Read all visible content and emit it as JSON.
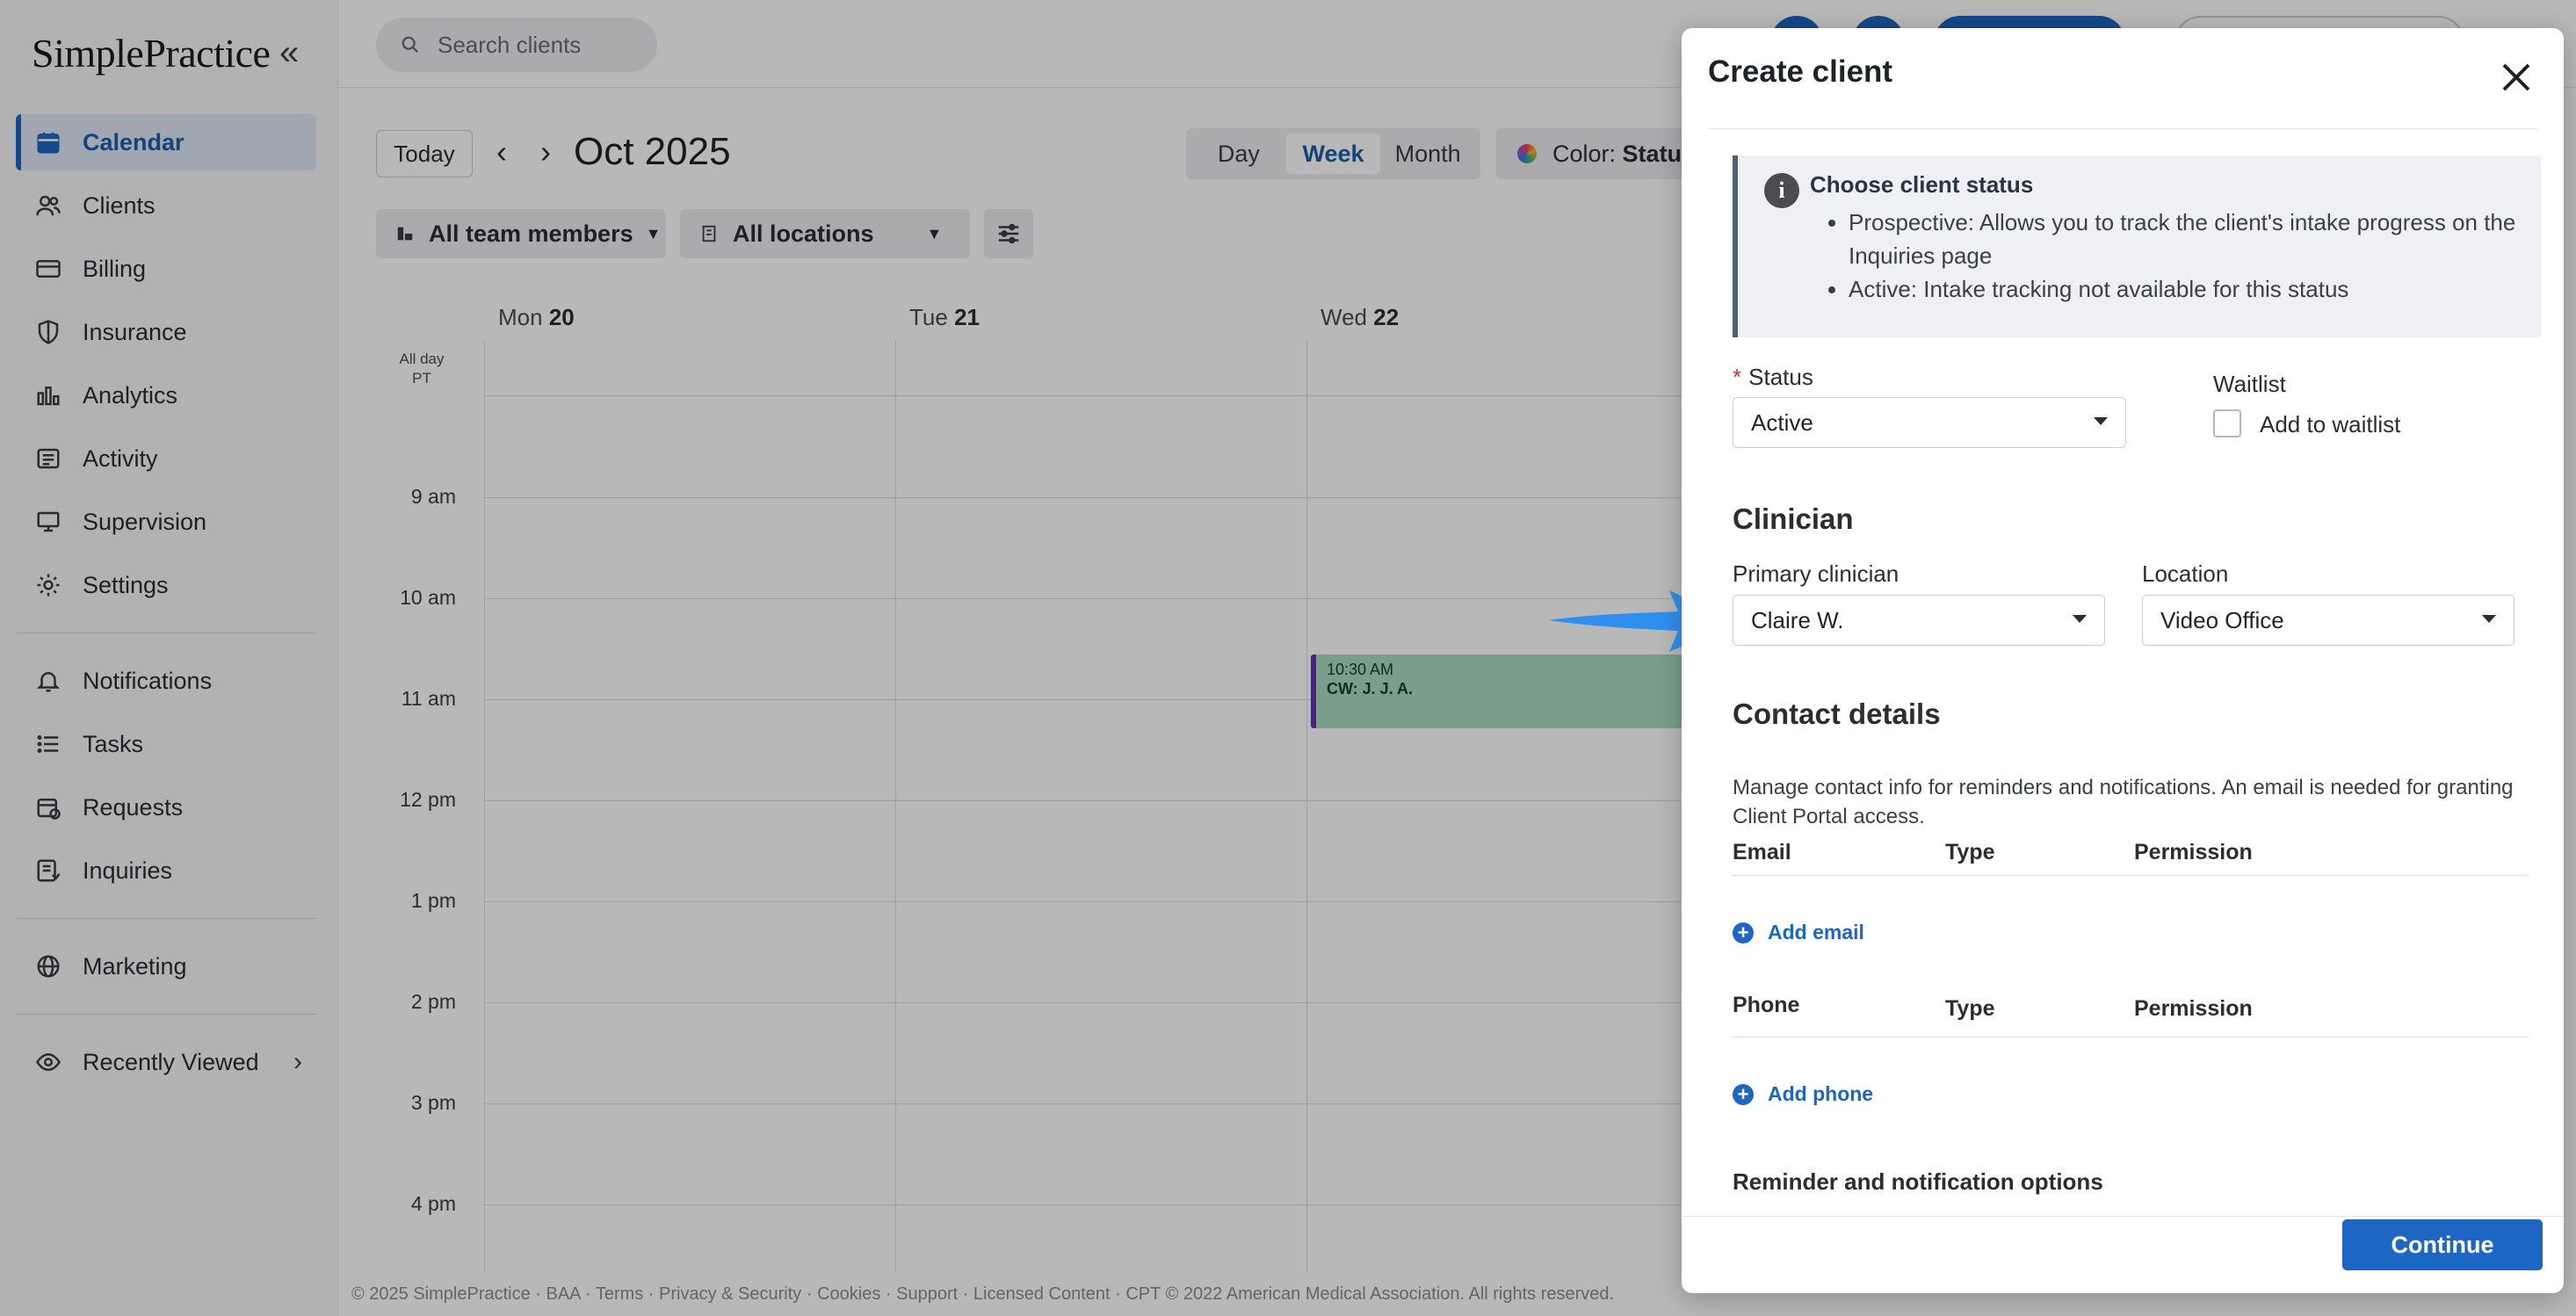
{
  "app": {
    "logo_text": "SimplePractice"
  },
  "sidebar": {
    "items": [
      {
        "label": "Calendar",
        "icon": "calendar-icon",
        "active": true
      },
      {
        "label": "Clients",
        "icon": "clients-icon"
      },
      {
        "label": "Billing",
        "icon": "billing-icon"
      },
      {
        "label": "Insurance",
        "icon": "shield-icon"
      },
      {
        "label": "Analytics",
        "icon": "analytics-icon"
      },
      {
        "label": "Activity",
        "icon": "activity-icon"
      },
      {
        "label": "Supervision",
        "icon": "supervision-icon"
      },
      {
        "label": "Settings",
        "icon": "gear-icon"
      }
    ],
    "secondary": [
      {
        "label": "Notifications",
        "icon": "bell-icon"
      },
      {
        "label": "Tasks",
        "icon": "tasks-icon"
      },
      {
        "label": "Requests",
        "icon": "requests-icon"
      },
      {
        "label": "Inquiries",
        "icon": "inquiries-icon"
      }
    ],
    "marketing": {
      "label": "Marketing",
      "icon": "globe-icon"
    },
    "recently_viewed": {
      "label": "Recently Viewed",
      "icon": "eye-icon"
    }
  },
  "topbar": {
    "search_placeholder": "Search clients"
  },
  "calendar": {
    "today_label": "Today",
    "month_label": "Oct 2025",
    "views": [
      "Day",
      "Week",
      "Month"
    ],
    "active_view": "Week",
    "color_label": "Color:",
    "color_value": "Status",
    "filters": {
      "team": "All team members",
      "locations": "All locations"
    },
    "days": [
      {
        "name": "Mon",
        "num": "20"
      },
      {
        "name": "Tue",
        "num": "21"
      },
      {
        "name": "Wed",
        "num": "22"
      }
    ],
    "allday": {
      "line1": "All day",
      "line2": "PT"
    },
    "hours": [
      "9 am",
      "10 am",
      "11 am",
      "12 pm",
      "1 pm",
      "2 pm",
      "3 pm",
      "4 pm"
    ],
    "appointment": {
      "time": "10:30 AM",
      "who": "CW: J. J. A."
    }
  },
  "footer": {
    "text": "© 2025 SimplePractice · BAA · Terms · Privacy & Security · Cookies · Support · Licensed Content · CPT © 2022 American Medical Association. All rights reserved."
  },
  "drawer": {
    "title": "Create client",
    "info": {
      "heading": "Choose client status",
      "bullets": [
        "Prospective: Allows you to track the client's intake progress on the Inquiries page",
        "Active: Intake tracking not available for this status"
      ]
    },
    "status": {
      "required_mark": "*",
      "label": "Status",
      "value": "Active"
    },
    "waitlist": {
      "label": "Waitlist",
      "checkbox_label": "Add to waitlist"
    },
    "clinician_section": "Clinician",
    "primary_clinician": {
      "label": "Primary clinician",
      "value": "Claire W."
    },
    "location": {
      "label": "Location",
      "value": "Video Office"
    },
    "contact_section": "Contact details",
    "contact_help": "Manage contact info for reminders and notifications. An email is needed for granting Client Portal access.",
    "email_headers": [
      "Email",
      "Type",
      "Permission"
    ],
    "add_email": "Add email",
    "phone_headers": [
      "Phone",
      "Type",
      "Permission"
    ],
    "add_phone": "Add phone",
    "reminder_title": "Reminder and notification options",
    "continue_label": "Continue"
  },
  "colors": {
    "primary": "#1d66c3",
    "appointment_bg": "#a9dcc0",
    "appointment_border": "#6b2fb0",
    "annotation_arrow": "#2f8ff0"
  }
}
